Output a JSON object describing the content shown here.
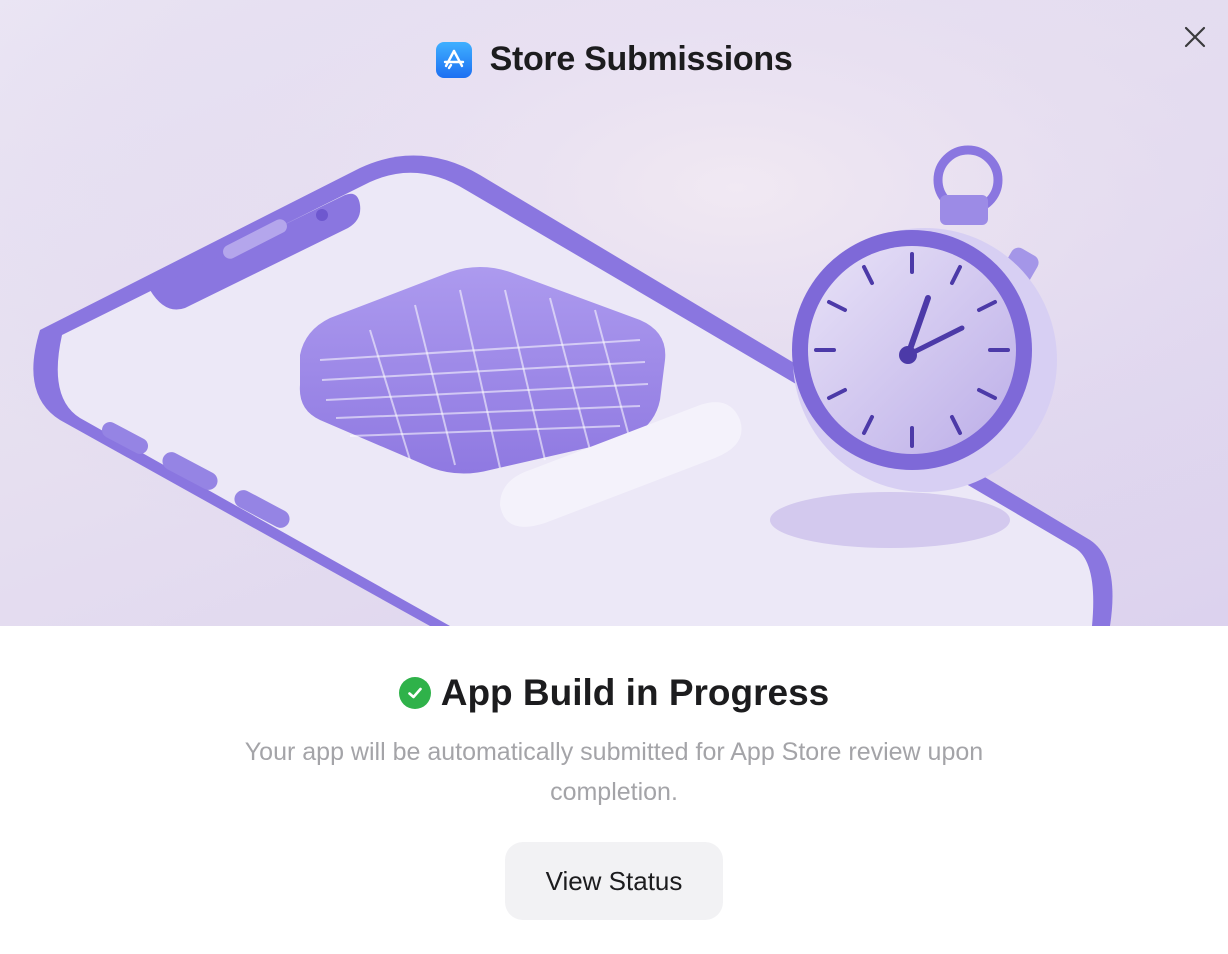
{
  "dialog": {
    "title": "Store Submissions",
    "app_icon": "app-store-icon",
    "close_icon": "close-icon"
  },
  "status": {
    "icon": "check-circle-icon",
    "title": "App Build in Progress",
    "description": "Your app will be automatically submitted for App Store review upon completion.",
    "button_label": "View Status"
  },
  "colors": {
    "accent_purple": "#7a66d6",
    "success_green": "#2fb24a",
    "app_icon_blue": "#1d6ff2"
  }
}
